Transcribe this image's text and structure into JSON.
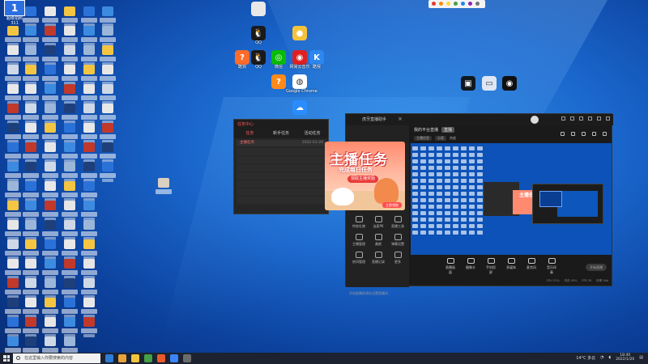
{
  "desktop": {
    "top_icon_label": "超级拍照",
    "top_icon_sub": "311",
    "named_icons": [
      {
        "label": "",
        "color": "#e8e8e8",
        "glyph": "",
        "icon": "stamp-icon"
      },
      {
        "label": "QQ",
        "color": "#1a1a1a",
        "glyph": "🐧",
        "icon": "qq-penguin-icon"
      },
      {
        "label": "",
        "color": "#f5c33b",
        "glyph": "●",
        "icon": "emoji-app-icon"
      },
      {
        "label": "酷狗",
        "color": "#ff6b2a",
        "glyph": "?",
        "icon": "music-app-icon"
      },
      {
        "label": "QQ",
        "color": "#1a1a1a",
        "glyph": "🐧",
        "icon": "qq-penguin-icon-2"
      },
      {
        "label": "微信",
        "color": "#09bb07",
        "glyph": "◎",
        "icon": "wechat-icon"
      },
      {
        "label": "网易云音乐",
        "color": "#e02020",
        "glyph": "◉",
        "icon": "netease-music-icon"
      },
      {
        "label": "酷我",
        "color": "#2d87f0",
        "glyph": "K",
        "icon": "kuwo-icon"
      },
      {
        "label": "",
        "color": "#ff8a1a",
        "glyph": "?",
        "icon": "help-app-icon"
      },
      {
        "label": "Google Chrome",
        "color": "#ffffff",
        "glyph": "◍",
        "icon": "chrome-icon"
      },
      {
        "label": "",
        "color": "#2a8cff",
        "glyph": "☁",
        "icon": "cloud-app-icon"
      },
      {
        "label": "",
        "color": "#101820",
        "glyph": "▣",
        "icon": "screen-tool-icon"
      },
      {
        "label": "",
        "color": "#dfe7f5",
        "glyph": "▭",
        "icon": "monitor-icon"
      },
      {
        "label": "",
        "color": "#101010",
        "glyph": "◉",
        "icon": "obs-icon"
      }
    ]
  },
  "task_center": {
    "title": "任务中心",
    "tabs": [
      "任务",
      "新手任务",
      "活动任务"
    ],
    "rows": [
      {
        "name": "主播任务",
        "date": "2022-01-20"
      }
    ]
  },
  "promo": {
    "headline": "主播任务",
    "subline": "完成每日任务",
    "banner": "领取主播奖励",
    "button": "立即领取"
  },
  "stream_app": {
    "brand": "虎牙直播助手",
    "room_title": "我的平台直播",
    "room_tag": "直播",
    "sub_items": [
      "主播信息",
      "分类",
      "热度"
    ],
    "left_tools": [
      {
        "label": "特效礼物"
      },
      {
        "label": "连麦PK"
      },
      {
        "label": "直播工具"
      },
      {
        "label": "主播管理"
      },
      {
        "label": "美颜"
      },
      {
        "label": "弹幕设置"
      },
      {
        "label": "房间管理"
      },
      {
        "label": "直播记录"
      },
      {
        "label": "更多"
      }
    ],
    "footer_note": "开始直播前请先设置直播间",
    "controls": [
      "直播画面",
      "摄像头",
      "手机投屏",
      "多媒体",
      "麦克风",
      "音乐伴奏"
    ],
    "go_live": "开始直播",
    "status": [
      "CPU 12%",
      "内存 45%",
      "FPS 30",
      "码率 0kb"
    ]
  },
  "taskbar": {
    "search_placeholder": "在这里输入你要搜索的内容",
    "app_colors": [
      "#2d7cd6",
      "#e8a23a",
      "#f2c53d",
      "#43a047",
      "#e85a2c",
      "#3b83ff",
      "#6b6b6b"
    ],
    "weather": "14°C 多云",
    "time": "18:40",
    "date": "2022/1/20"
  }
}
